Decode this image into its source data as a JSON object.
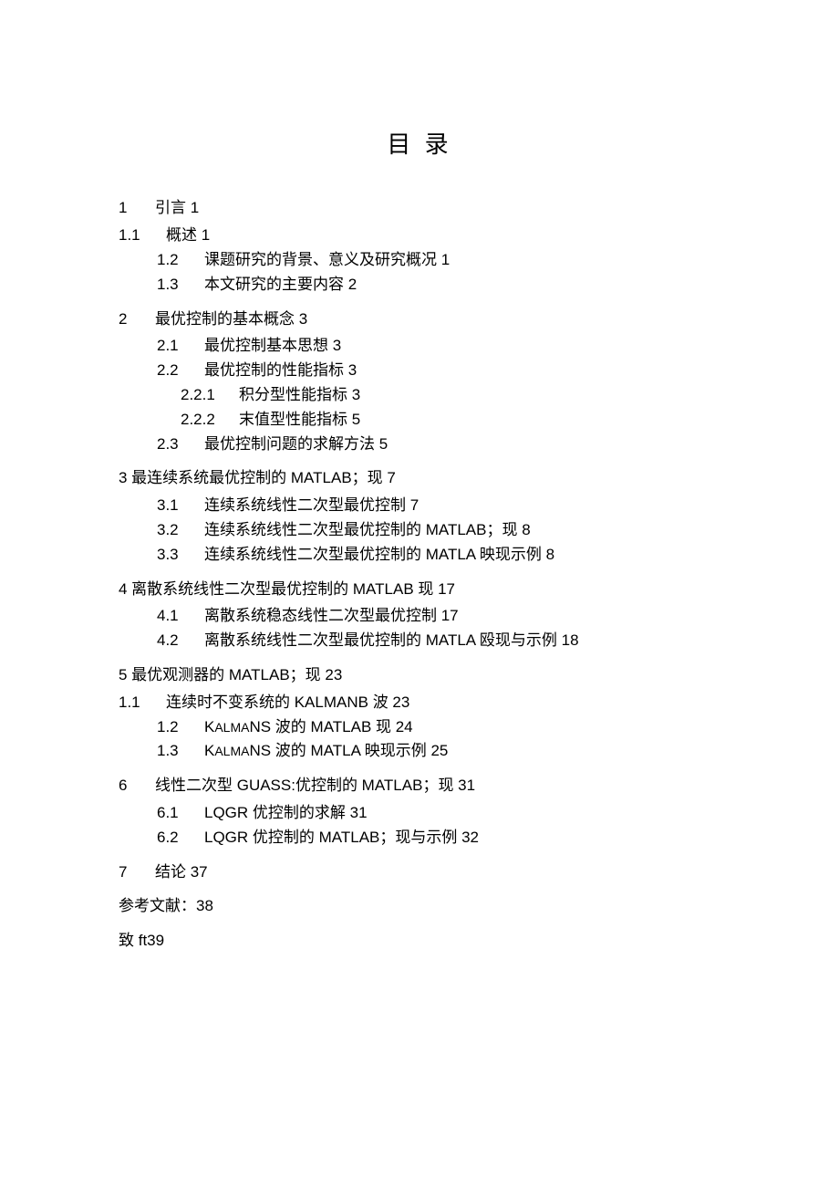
{
  "title": "目 录",
  "toc": {
    "s1_num": "1",
    "s1_txt": "引言 1",
    "s1_1_num": "1.1",
    "s1_1_txt": "概述 1",
    "s1_2_num": "1.2",
    "s1_2_txt": "课题研究的背景、意义及研究概况 1",
    "s1_3_num": "1.3",
    "s1_3_txt": "本文研究的主要内容 2",
    "s2_num": "2",
    "s2_txt": "最优控制的基本概念 3",
    "s2_1_num": "2.1",
    "s2_1_txt": "最优控制基本思想 3",
    "s2_2_num": "2.2",
    "s2_2_txt": "最优控制的性能指标 3",
    "s2_2_1_num": "2.2.1",
    "s2_2_1_txt": "积分型性能指标 3",
    "s2_2_2_num": "2.2.2",
    "s2_2_2_txt": "末值型性能指标 5",
    "s2_3_num": "2.3",
    "s2_3_txt": "最优控制问题的求解方法 5",
    "s3_txt": "3 最连续系统最优控制的 MATLAB；现 7",
    "s3_1_num": "3.1",
    "s3_1_txt": "连续系统线性二次型最优控制 7",
    "s3_2_num": "3.2",
    "s3_2_txt": "连续系统线性二次型最优控制的 MATLAB；现 8",
    "s3_3_num": "3.3",
    "s3_3_txt": "连续系统线性二次型最优控制的 MATLA 映现示例 8",
    "s4_txt": "4 离散系统线性二次型最优控制的 MATLAB 现 17",
    "s4_1_num": "4.1",
    "s4_1_txt": "离散系统稳态线性二次型最优控制 17",
    "s4_2_num": "4.2",
    "s4_2_txt": "离散系统线性二次型最优控制的 MATLA 殴现与示例 18",
    "s5_txt": "5 最优观测器的 MATLAB；现 23",
    "s5_0_num": "1.1",
    "s5_0_txt": "连续时不变系统的 KALMANB 波 23",
    "s5_1_num": "1.2",
    "s5_1_pre": "K",
    "s5_1_sc": "ALMA",
    "s5_1_post": "NS 波的 MATLAB 现 24",
    "s5_2_num": "1.3",
    "s5_2_pre": "K",
    "s5_2_sc": "ALMA",
    "s5_2_post": "NS 波的 MATLA 映现示例 25",
    "s6_num": "6",
    "s6_txt": "线性二次型 GUASS:优控制的 MATLAB；现 31",
    "s6_1_num": "6.1",
    "s6_1_txt": "LQGR 优控制的求解 31",
    "s6_2_num": "6.2",
    "s6_2_txt": "LQGR 优控制的 MATLAB；现与示例 32",
    "s7_num": "7",
    "s7_txt": "结论 37",
    "ref_txt": "参考文献：38",
    "ack_txt": "致 ft39"
  }
}
